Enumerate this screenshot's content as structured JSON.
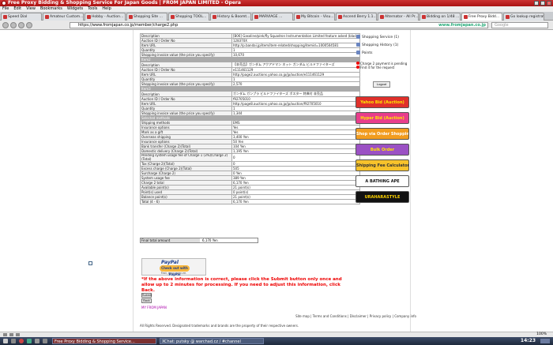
{
  "window": {
    "title": "Free Proxy Bidding & Shopping Service For Japan Goods | FROM JAPAN LIMITED - Opera"
  },
  "menu": [
    "File",
    "Edit",
    "View",
    "Bookmarks",
    "Widgets",
    "Tools",
    "Help"
  ],
  "tabs": [
    {
      "label": "Speed Dial",
      "active": false
    },
    {
      "label": "Amateur Custom...",
      "active": false
    },
    {
      "label": "Hobby - Auction...",
      "active": false
    },
    {
      "label": "Shopping Site ...",
      "active": false
    },
    {
      "label": "Shopping TOOL...",
      "active": false
    },
    {
      "label": "History & Boomt...",
      "active": false
    },
    {
      "label": "MARVIAGE ...",
      "active": false
    },
    {
      "label": "My Bitcoin - Visu...",
      "active": false
    },
    {
      "label": "Ascend Berry 1.1...",
      "active": false
    },
    {
      "label": "Alternator - All Pr...",
      "active": false
    },
    {
      "label": "Bidding on 1/48 ...",
      "active": false
    },
    {
      "label": "Free Proxy Bidd...",
      "active": true
    },
    {
      "label": "Go lookup registration...",
      "active": false
    }
  ],
  "address": {
    "url": "https://www.fromjapan.co.jp/member/charge2.php",
    "site_badge": "www.fromjapan.co.jp",
    "search_placeholder": "Google"
  },
  "order_table": [
    {
      "type": "row",
      "k": "Description",
      "v": "[B06] Gasoline/pink/fly Squadron Instrumentation Limited feature asked (black)"
    },
    {
      "type": "row",
      "k": "Auction ID / Order No",
      "v": "128370X"
    },
    {
      "type": "row",
      "k": "Item URL",
      "v": "http://p.bandai.jp/item/item-related/shopping/itemid=1000504581"
    },
    {
      "type": "row",
      "k": "Quantity",
      "v": "1"
    },
    {
      "type": "row",
      "k": "Shopping invoice value (the price you specify)",
      "v": "10,670"
    },
    {
      "type": "sec",
      "k": "Item2",
      "v": ""
    },
    {
      "type": "row",
      "k": "Description",
      "v": "【非売品】ガンダム アクアドマン ネット ガンダム ビルドファイターズ"
    },
    {
      "type": "row",
      "k": "Auction ID / Order No",
      "v": "e111461129"
    },
    {
      "type": "row",
      "k": "Item URL",
      "v": "http://page2.auctions.yahoo.co.jp/jp/auction/e111461129"
    },
    {
      "type": "row",
      "k": "Quantity",
      "v": "1"
    },
    {
      "type": "row",
      "k": "Shopping invoice value (the price you specify)",
      "v": "2,570"
    },
    {
      "type": "sec",
      "k": "Item3",
      "v": ""
    },
    {
      "type": "row",
      "k": "Description",
      "v": "ガンダム ガンプラ ビルドファイターズ ポスター 特典付 非売品"
    },
    {
      "type": "row",
      "k": "Auction ID / Order No",
      "v": "f92705010"
    },
    {
      "type": "row",
      "k": "Item URL",
      "v": "http://page8.auctions.yahoo.co.jp/jp/auction/f92705010"
    },
    {
      "type": "row",
      "k": "Quantity",
      "v": "1"
    },
    {
      "type": "row",
      "k": "Shopping invoice value (the price you specify)",
      "v": "1,344"
    },
    {
      "type": "sec",
      "k": "Selected methods",
      "v": ""
    },
    {
      "type": "row",
      "k": "Shipping methods",
      "v": "EMS"
    },
    {
      "type": "row",
      "k": "Insurance options",
      "v": "Yes"
    },
    {
      "type": "row",
      "k": "Mark as a gift",
      "v": "Yes"
    },
    {
      "type": "row",
      "k": "Overseas shipping",
      "v": "3,400 Yen"
    },
    {
      "type": "row",
      "k": "Insurance options",
      "v": "50 Yen"
    },
    {
      "type": "row",
      "k": "Bank transfer (Charge 2)(Total)",
      "v": "104 Yen"
    },
    {
      "type": "row",
      "k": "Domestic delivery (Charge 2)(Total)",
      "v": "1,195 Yen"
    },
    {
      "type": "row2",
      "k": "Pending system usage fee of Charge 1 (3%)(Charge 2)(Total)",
      "v": "0"
    },
    {
      "type": "row",
      "k": "Tax (Charge 2)(Total)",
      "v": "0"
    },
    {
      "type": "row",
      "k": "Excess charge (Charge 2)(Total)",
      "v": "505"
    },
    {
      "type": "row",
      "k": "Surcharge (Charge 2)",
      "v": "0 Yen"
    },
    {
      "type": "row",
      "k": "System usage fee",
      "v": "389 Yen"
    },
    {
      "type": "row",
      "k": "Charge 2 total",
      "v": "6,170 Yen"
    },
    {
      "type": "row",
      "k": "Available point(s)",
      "v": "21 point(s)"
    },
    {
      "type": "row",
      "k": "Point(s) used",
      "v": "0 point(s)"
    },
    {
      "type": "row",
      "k": "Balance point(s)",
      "v": "21 point(s)"
    },
    {
      "type": "row",
      "k": "Total (4 - 6)",
      "v": "6,170 Yen"
    }
  ],
  "final": {
    "label": "Final total amount",
    "value": "6,170 Yen"
  },
  "paypal": {
    "logo": "PayPal",
    "button": "Check out with PayPal",
    "subtext": "Fast, easy, secure."
  },
  "warning": "*If the above information is correct, please click the Submit button only once and allow up to 2 minutes for processing. If you need to adjust this information, click Back.",
  "buttons": {
    "submit": "Submit",
    "back": "Back"
  },
  "myfrom": "MY FROM JAPAN",
  "footer": {
    "links": [
      "Site map",
      "Terms and Conditions",
      "Disclaimer",
      "Privacy policy",
      "Company info"
    ],
    "copyright": "All Rights Reserved. Designated trademarks and brands are the property of their respective owners."
  },
  "sidebar": {
    "links": [
      "Shopping Service (1)",
      "Shopping History (1)",
      "Points"
    ],
    "notice_title": "Charge 2 payment is pending",
    "notice_action": "Find it for the request",
    "logout": "Logout",
    "banners": [
      {
        "label": "Yahoo Bid (Auction)",
        "bg": "#e0302b",
        "fg": "#ffe600"
      },
      {
        "label": "Hyper Bid (Auction)",
        "bg": "#e83e8c",
        "fg": "#ffe600"
      },
      {
        "label": "Shop via Order Shopping",
        "bg": "#f29c1f",
        "fg": "#ffffff"
      },
      {
        "label": "Bulk Order",
        "bg": "#9b51c4",
        "fg": "#ffe600"
      },
      {
        "label": "Shipping Fee Calculator",
        "bg": "#f7c22b",
        "fg": "#333333"
      },
      {
        "label": "A BATHING APE",
        "bg": "#ffffff",
        "fg": "#111111"
      },
      {
        "label": "URAHARASTYLE",
        "bg": "#111111",
        "fg": "#ffd400"
      }
    ]
  },
  "statusbar": {
    "zoom": "100%"
  },
  "taskbar": {
    "items": [
      {
        "label": "Free Proxy Bidding & Shopping Service...",
        "active": true
      },
      {
        "label": "XChat: putsky @ warchad.cz / #channel",
        "active": false
      }
    ],
    "clock": "14:23"
  }
}
